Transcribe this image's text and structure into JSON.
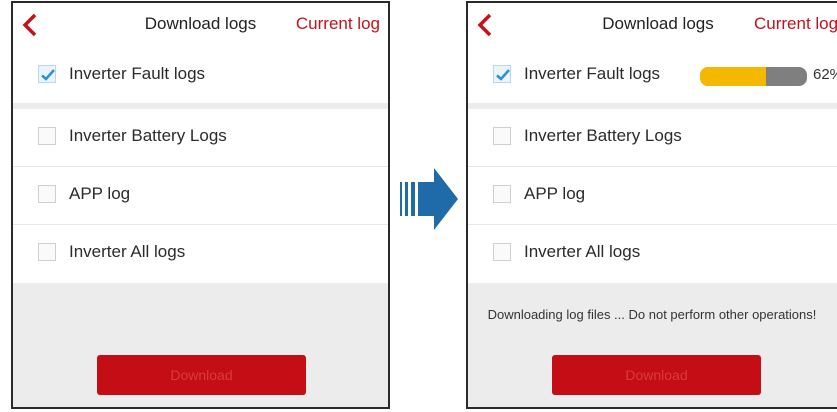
{
  "screens": [
    {
      "header": {
        "title": "Download logs",
        "current_log": "Current log"
      },
      "items": [
        {
          "label": "Inverter Fault logs",
          "checked": true
        },
        {
          "label": "Inverter Battery Logs",
          "checked": false
        },
        {
          "label": "APP log",
          "checked": false
        },
        {
          "label": "Inverter All logs",
          "checked": false
        }
      ],
      "download_label": "Download"
    },
    {
      "header": {
        "title": "Download logs",
        "current_log": "Current log"
      },
      "items": [
        {
          "label": "Inverter Fault logs",
          "checked": true,
          "progress_fraction": 0.62,
          "progress_text": "62%"
        },
        {
          "label": "Inverter Battery Logs",
          "checked": false
        },
        {
          "label": "APP log",
          "checked": false
        },
        {
          "label": "Inverter All logs",
          "checked": false
        }
      ],
      "status_message": "Downloading log files ... Do not perform other operations!",
      "download_label": "Download"
    }
  ],
  "colors": {
    "accent": "#c8101a",
    "button": "#c40d14",
    "check": "#2b8fd6",
    "progress_fill": "#f5b800",
    "progress_track": "#7f7f7f",
    "arrow": "#1f6aa8"
  },
  "icons": {
    "back": "chevron-left-icon",
    "check": "checkmark-icon",
    "transition": "right-arrow-icon"
  }
}
